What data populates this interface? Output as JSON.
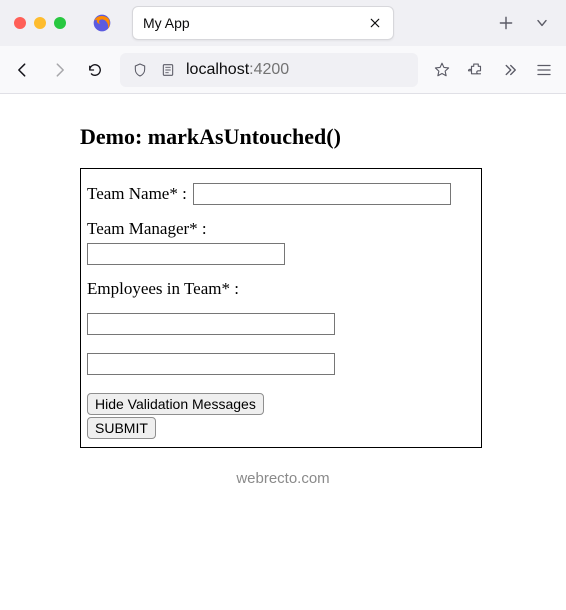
{
  "chrome": {
    "tab_title": "My App",
    "url_host": "localhost",
    "url_port": ":4200"
  },
  "page": {
    "heading": "Demo: markAsUntouched()",
    "form": {
      "team_name_label": "Team Name* :",
      "team_name_value": "",
      "team_manager_label": "Team Manager* :",
      "team_manager_value": "",
      "employees_label": "Employees in Team* :",
      "employees": [
        {
          "value": ""
        },
        {
          "value": ""
        }
      ],
      "hide_btn": "Hide Validation Messages",
      "submit_btn": "SUBMIT"
    },
    "footer": "webrecto.com"
  }
}
